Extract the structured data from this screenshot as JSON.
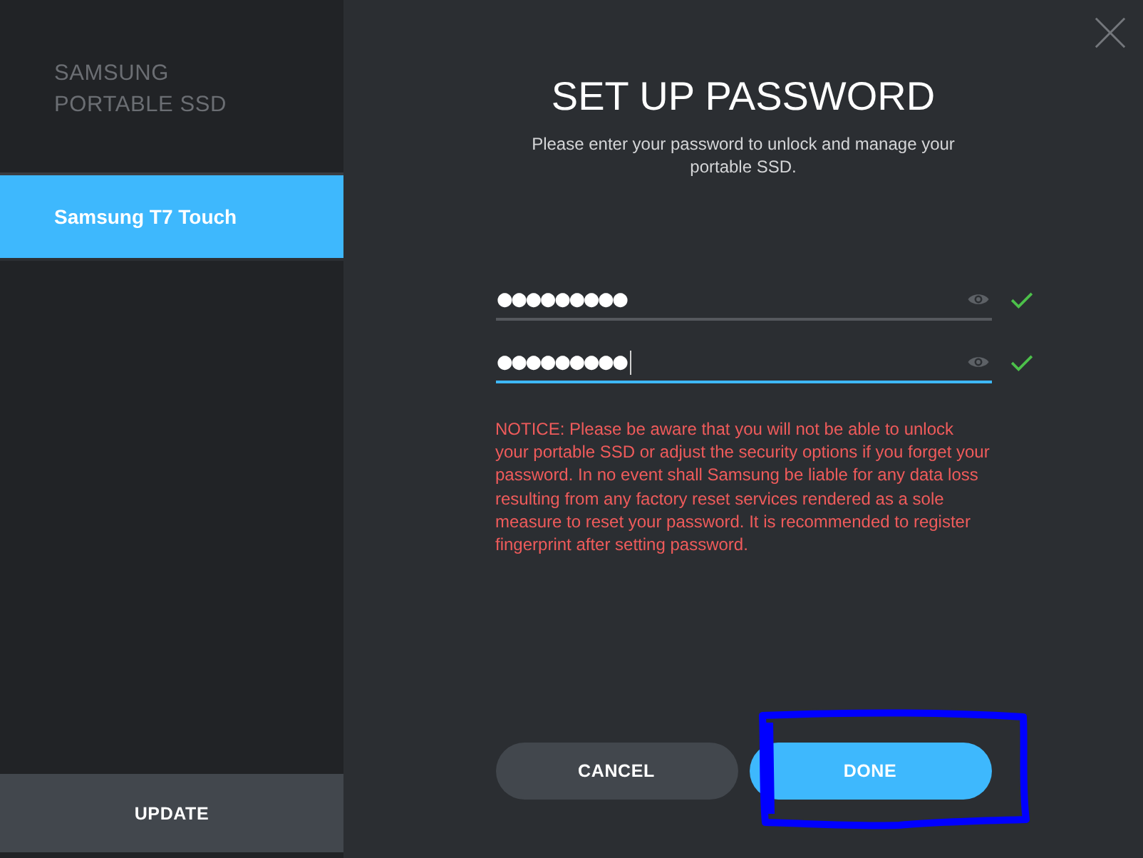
{
  "sidebar": {
    "logo": [
      "SAMSUNG",
      "PORTABLE SSD"
    ],
    "devices": [
      {
        "label": "Samsung T7 Touch",
        "selected": true
      }
    ],
    "update_button": "UPDATE"
  },
  "dialog": {
    "title": "SET UP PASSWORD",
    "subtitle": "Please enter your password to unlock and manage your portable SSD.",
    "fields": [
      {
        "value": "●●●●●●●●●",
        "focused": false,
        "valid": true
      },
      {
        "value": "●●●●●●●●●",
        "focused": true,
        "valid": true
      }
    ],
    "notice": "NOTICE: Please be aware that you will not be able to unlock your portable SSD or adjust the security options if you forget your password. In no event shall Samsung be liable for any data loss resulting from any factory reset services rendered as a sole measure to reset your password. It is recommended to register fingerprint after setting password.",
    "buttons": [
      {
        "label": "CANCEL",
        "kind": "cancel",
        "highlighted": false
      },
      {
        "label": "DONE",
        "kind": "done",
        "highlighted": true
      }
    ]
  }
}
